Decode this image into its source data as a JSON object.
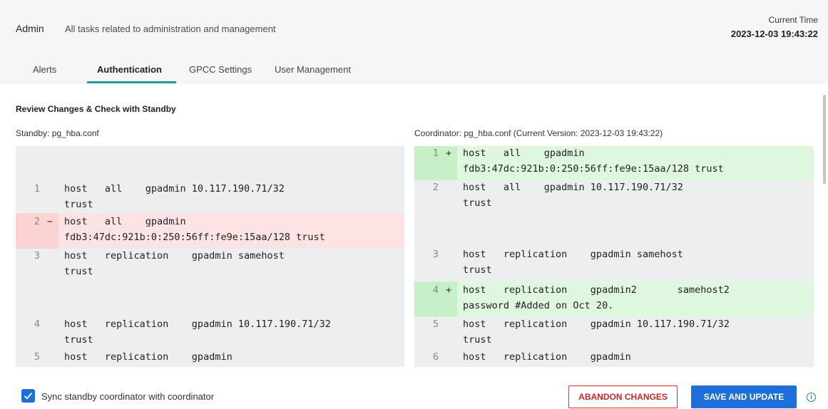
{
  "header": {
    "title": "Admin",
    "description": "All tasks related to administration and management",
    "time_label": "Current Time",
    "time_value": "2023-12-03 19:43:22"
  },
  "tabs": [
    {
      "label": "Alerts",
      "active": false
    },
    {
      "label": "Authentication",
      "active": true
    },
    {
      "label": "GPCC Settings",
      "active": false
    },
    {
      "label": "User Management",
      "active": false
    }
  ],
  "review": {
    "title": "Review Changes & Check with Standby",
    "standby_label": "Standby: pg_hba.conf",
    "coordinator_label": "Coordinator: pg_hba.conf (Current Version: 2023-12-03 19:43:22)"
  },
  "standby_rows": [
    {
      "ln": "1",
      "sign": "",
      "type": "ctx",
      "lines": [
        "host   all    gpadmin 10.117.190.71/32",
        "trust"
      ]
    },
    {
      "ln": "2",
      "sign": "−",
      "type": "del",
      "lines": [
        "host   all    gpadmin",
        "fdb3:47dc:921b:0:250:56ff:fe9e:15aa/128 trust"
      ]
    },
    {
      "ln": "3",
      "sign": "",
      "type": "ctx",
      "lines": [
        "host   replication    gpadmin samehost",
        "trust"
      ]
    },
    {
      "ln": "4",
      "sign": "",
      "type": "ctx",
      "lines": [
        "host   replication    gpadmin 10.117.190.71/32",
        "trust"
      ]
    },
    {
      "ln": "5",
      "sign": "",
      "type": "ctx",
      "lines": [
        "host   replication    gpadmin"
      ]
    }
  ],
  "coordinator_rows": [
    {
      "ln": "1",
      "sign": "+",
      "type": "add",
      "lines": [
        "host   all    gpadmin",
        "fdb3:47dc:921b:0:250:56ff:fe9e:15aa/128 trust"
      ]
    },
    {
      "ln": "2",
      "sign": "",
      "type": "ctx",
      "lines": [
        "host   all    gpadmin 10.117.190.71/32",
        "trust"
      ]
    },
    {
      "ln": "3",
      "sign": "",
      "type": "ctx",
      "lines": [
        "host   replication    gpadmin samehost",
        "trust"
      ]
    },
    {
      "ln": "4",
      "sign": "+",
      "type": "add",
      "lines": [
        "host   replication    gpadmin2       samehost2",
        "password #Added on Oct 20."
      ]
    },
    {
      "ln": "5",
      "sign": "",
      "type": "ctx",
      "lines": [
        "host   replication    gpadmin 10.117.190.71/32",
        "trust"
      ]
    },
    {
      "ln": "6",
      "sign": "",
      "type": "ctx",
      "lines": [
        "host   replication    gpadmin"
      ]
    }
  ],
  "footer": {
    "sync_label": "Sync standby coordinator with coordinator",
    "sync_checked": true,
    "abandon_label": "ABANDON CHANGES",
    "save_label": "SAVE AND UPDATE"
  },
  "colors": {
    "accent": "#1e6fd9",
    "tab_underline": "#1f9e9a",
    "danger": "#c62828",
    "deleted_bg": "#fde3e3",
    "added_bg": "#dff7df"
  },
  "icons": {
    "checkbox": "check-icon",
    "info": "info-icon"
  }
}
